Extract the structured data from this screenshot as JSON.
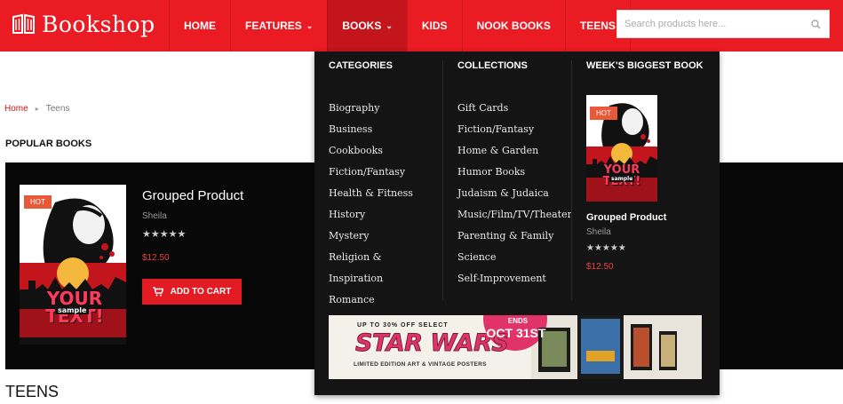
{
  "header": {
    "logo_text": "Bookshop",
    "nav": [
      {
        "label": "HOME",
        "dropdown": false
      },
      {
        "label": "FEATURES",
        "dropdown": true
      },
      {
        "label": "BOOKS",
        "dropdown": true,
        "active": true
      },
      {
        "label": "KIDS",
        "dropdown": false
      },
      {
        "label": "NOOK BOOKS",
        "dropdown": false
      },
      {
        "label": "TEENS",
        "dropdown": false
      }
    ],
    "search_placeholder": "Search products here..."
  },
  "breadcrumb": {
    "home": "Home",
    "current": "Teens"
  },
  "popular_title": "POPULAR BOOKS",
  "product": {
    "badge": "HOT",
    "title": "Grouped Product",
    "author": "Sheila",
    "stars": "★★★★★",
    "price": "$12.50",
    "cart_label": "ADD TO CART",
    "cover_text": "YOUR TEXT!",
    "cover_stamp": "sample"
  },
  "teens_heading": "TEENS",
  "mega_menu": {
    "categories_title": "CATEGORIES",
    "categories": [
      "Biography",
      "Business",
      "Cookbooks",
      "Fiction/Fantasy",
      "Health & Fitness",
      "History",
      "Mystery",
      "Religion &",
      "Inspiration",
      "Romance"
    ],
    "collections_title": "COLLECTIONS",
    "collections": [
      "Gift Cards",
      "Fiction/Fantasy",
      "Home & Garden",
      "Humor Books",
      "Judaism & Judaica",
      "Music/Film/TV/Theater",
      "Parenting & Family",
      "Science",
      "Self-Improvement"
    ],
    "weekly_title": "WEEK'S BIGGEST BOOK",
    "weekly": {
      "badge": "HOT",
      "title": "Grouped Product",
      "author": "Sheila",
      "stars": "★★★★★",
      "price": "$12.50"
    },
    "banner": {
      "top_text": "UP TO 30% OFF SELECT",
      "headline": "STAR WARS",
      "sub_text": "LIMITED EDITION ART & VINTAGE POSTERS",
      "badge_line1": "ENDS",
      "badge_line2": "OCT 31ST"
    }
  },
  "colors": {
    "brand_red": "#ea1b23",
    "active_nav": "#c4151c",
    "menu_bg": "#141414",
    "price": "#e8433a",
    "hot_badge": "#e8593a"
  }
}
